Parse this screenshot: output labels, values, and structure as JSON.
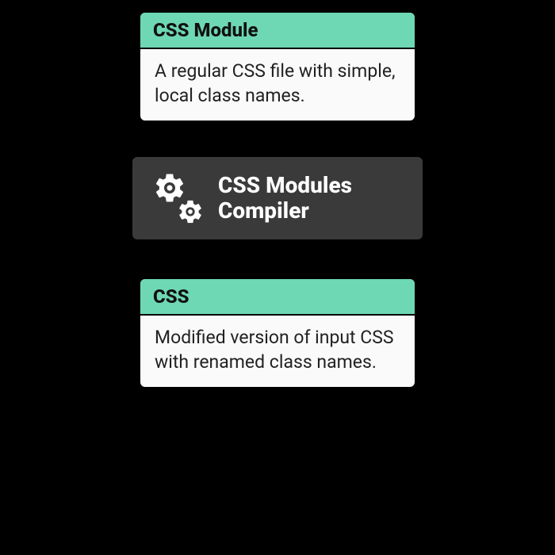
{
  "input_card": {
    "title": "CSS Module",
    "description": "A regular CSS file with simple, local class names."
  },
  "compiler": {
    "label": "CSS Modules Compiler"
  },
  "output_card": {
    "title": "CSS",
    "description": "Modified version of input CSS with renamed class names."
  },
  "colors": {
    "teal": "#6ed8b4",
    "dark": "#3a3a3a",
    "background": "#000000"
  }
}
